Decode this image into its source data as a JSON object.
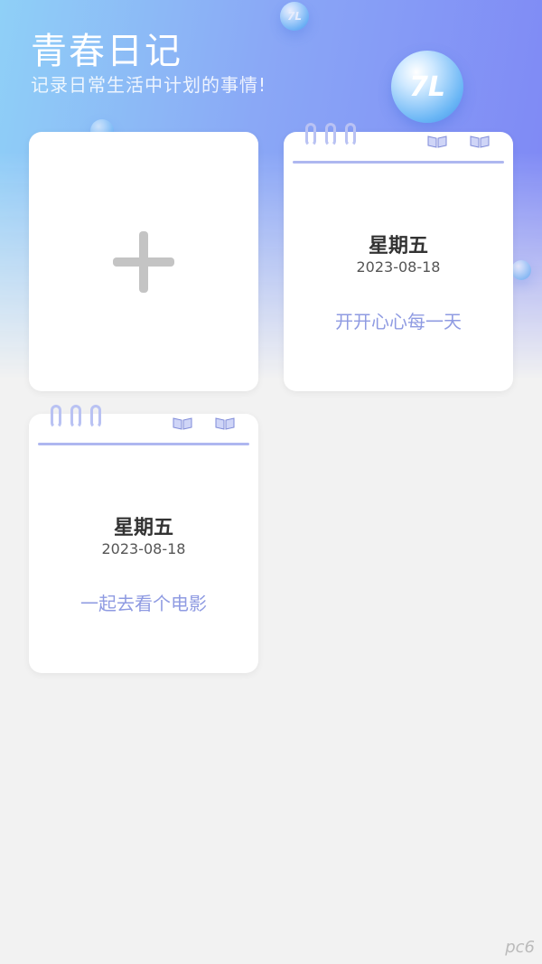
{
  "header": {
    "title": "青春日记",
    "subtitle": "记录日常生活中计划的事情!"
  },
  "colors": {
    "accent": "#8f9be2",
    "rule": "#aeb7f0",
    "background": "#f2f2f2"
  },
  "entries": [
    {
      "weekday": "星期五",
      "date": "2023-08-18",
      "note": "开开心心每一天"
    },
    {
      "weekday": "星期五",
      "date": "2023-08-18",
      "note": "一起去看个电影"
    }
  ],
  "watermark": "pc6"
}
